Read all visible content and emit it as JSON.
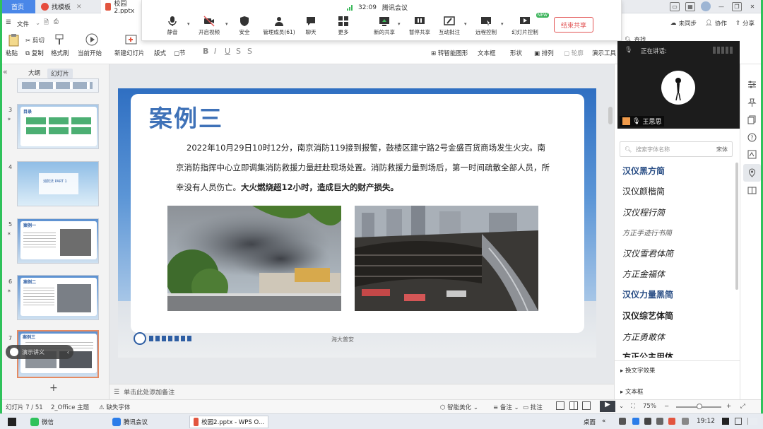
{
  "tabs": {
    "home": "首页",
    "template": "找模板",
    "file": "校园2.pptx"
  },
  "meeting": {
    "time": "32:09",
    "title": "腾讯会议",
    "buttons": {
      "mute": "静音",
      "video": "开启视频",
      "security": "安全",
      "members": "管理成员(61)",
      "chat": "聊天",
      "more": "更多",
      "new_share": "新的共享",
      "pause_share": "暂停共享",
      "annotate": "互动批注",
      "remote": "远程控制",
      "slide_control": "幻灯片控制",
      "new_badge": "NEW"
    },
    "end_share": "结束共享"
  },
  "ribbon": {
    "file_menu": "文件",
    "cut": "剪切",
    "copy": "复制",
    "format_painter": "格式刷",
    "paste": "粘贴",
    "play_from_current": "当前开始",
    "new_slide": "新建幻灯片",
    "layout": "版式",
    "section": "节",
    "smartart": "转智能图形",
    "textbox": "文本框",
    "shape": "形状",
    "arrange": "排列",
    "outline": "轮廓",
    "presenter_tools": "演示工具",
    "find": "查找",
    "unsynced": "未同步",
    "collab": "协作",
    "share": "分享"
  },
  "left_panel": {
    "tab_outline": "大纲",
    "tab_slides": "幻灯片",
    "narrator": "演示讲义"
  },
  "thumbnails": [
    {
      "num": "3",
      "title": "目录"
    },
    {
      "num": "4",
      "title": "消防法 PART 1"
    },
    {
      "num": "5",
      "title": "案例一"
    },
    {
      "num": "6",
      "title": "案例二"
    },
    {
      "num": "7",
      "title": "案例三"
    }
  ],
  "slide": {
    "title": "案例三",
    "body_normal": "2022年10月29日10时12分，南京消防119接到报警，鼓楼区建宁路2号金盛百货商场发生火灾。南京消防指挥中心立即调集消防救援力量赶赴现场处置。消防救援力量到场后，第一时间疏散全部人员，所幸没有人员伤亡。",
    "body_bold": "大火燃烧超12小时，造成巨大的财产损失。",
    "footer": "海大普安"
  },
  "notes_placeholder": "单击此处添加备注",
  "right_panel": {
    "speaking_label": "正在讲话:",
    "speaker_name": "王思思",
    "font_search_placeholder": "搜索字体名称",
    "font_tag": "宋体",
    "fonts": [
      "汉仪黑方简",
      "汉仪颜楷简",
      "汉仪程行简",
      "方正手迹行书简",
      "汉仪雪君体简",
      "方正金福体",
      "汉仪力量黑简",
      "汉仪综艺体简",
      "方正勇敢体",
      "方正公主用体"
    ],
    "change_effect": "换文字效果",
    "textbox": "文本框"
  },
  "status": {
    "slide_pos": "幻灯片 7 / 51",
    "theme": "2_Office 主题",
    "missing_font": "缺失字体",
    "beautify": "智能美化",
    "notes": "备注",
    "comments": "批注",
    "zoom": "75%"
  },
  "taskbar": {
    "wechat": "微信",
    "meeting": "腾讯会议",
    "wps": "校园2.pptx - WPS O...",
    "desktop": "桌面",
    "clock": "19:12"
  }
}
